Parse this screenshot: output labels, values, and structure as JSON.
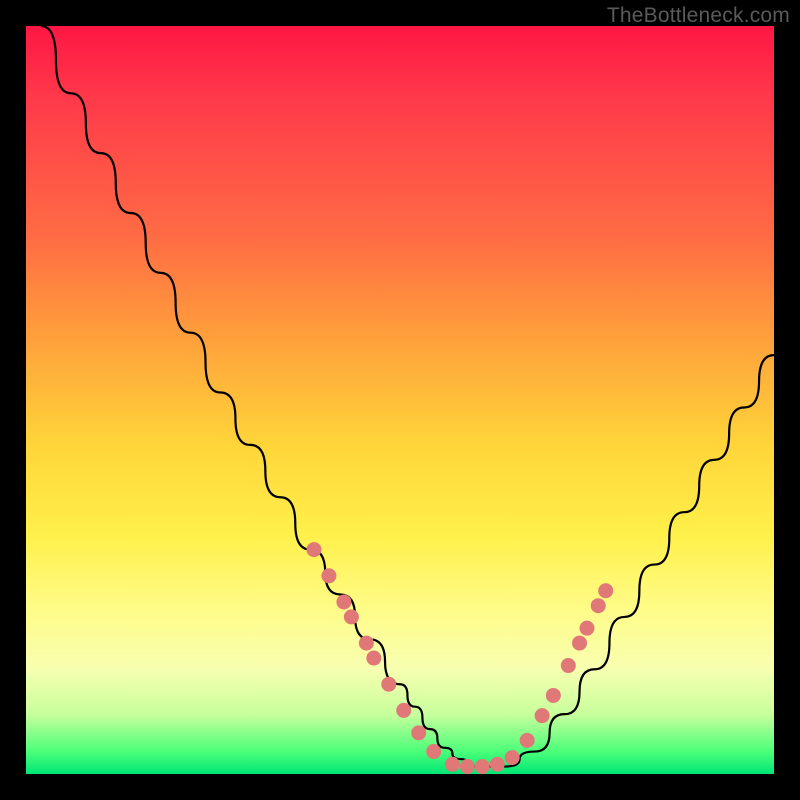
{
  "watermark": "TheBottleneck.com",
  "chart_data": {
    "type": "line",
    "title": "",
    "xlabel": "",
    "ylabel": "",
    "xlim": [
      0,
      100
    ],
    "ylim": [
      0,
      100
    ],
    "series": [
      {
        "name": "bottleneck-curve",
        "x": [
          2,
          6,
          10,
          14,
          18,
          22,
          26,
          30,
          34,
          38,
          42,
          46,
          50,
          52,
          54,
          56,
          58,
          60,
          64,
          68,
          72,
          76,
          80,
          84,
          88,
          92,
          96,
          100
        ],
        "values": [
          100,
          91,
          83,
          75,
          67,
          59,
          51,
          44,
          37,
          30,
          24,
          18,
          12,
          9,
          6,
          3.5,
          2,
          1,
          1,
          3,
          8,
          14,
          21,
          28,
          35,
          42,
          49,
          56
        ]
      }
    ],
    "markers": {
      "name": "scatter-dots",
      "color": "#e07878",
      "points": [
        {
          "x": 38.5,
          "y": 30
        },
        {
          "x": 40.5,
          "y": 26.5
        },
        {
          "x": 42.5,
          "y": 23
        },
        {
          "x": 43.5,
          "y": 21
        },
        {
          "x": 45.5,
          "y": 17.5
        },
        {
          "x": 46.5,
          "y": 15.5
        },
        {
          "x": 48.5,
          "y": 12
        },
        {
          "x": 50.5,
          "y": 8.5
        },
        {
          "x": 52.5,
          "y": 5.5
        },
        {
          "x": 54.5,
          "y": 3
        },
        {
          "x": 57,
          "y": 1.3
        },
        {
          "x": 59,
          "y": 1
        },
        {
          "x": 61,
          "y": 1
        },
        {
          "x": 63,
          "y": 1.3
        },
        {
          "x": 65,
          "y": 2.2
        },
        {
          "x": 67,
          "y": 4.5
        },
        {
          "x": 69,
          "y": 7.8
        },
        {
          "x": 70.5,
          "y": 10.5
        },
        {
          "x": 72.5,
          "y": 14.5
        },
        {
          "x": 74,
          "y": 17.5
        },
        {
          "x": 75,
          "y": 19.5
        },
        {
          "x": 76.5,
          "y": 22.5
        },
        {
          "x": 77.5,
          "y": 24.5
        }
      ]
    }
  }
}
